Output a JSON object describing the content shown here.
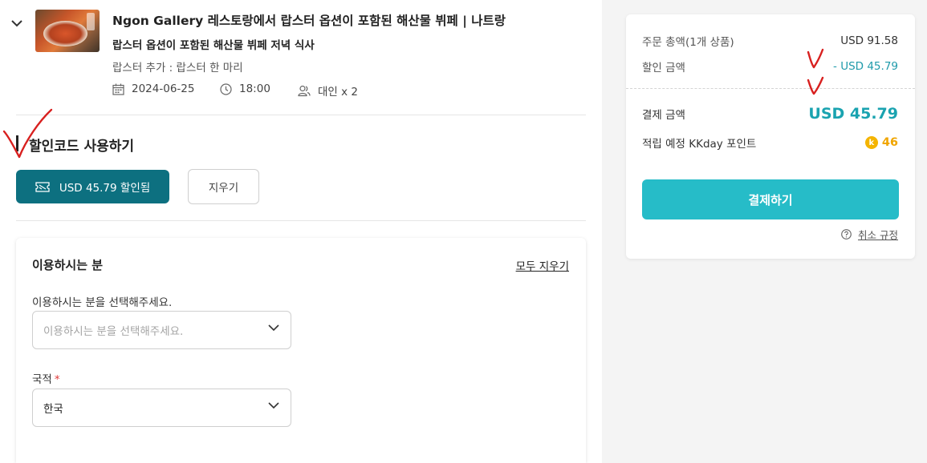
{
  "product": {
    "title": "Ngon Gallery 레스토랑에서 랍스터 옵션이 포함된 해산물 뷔페 | 나트랑",
    "package": "랍스터 옵션이 포함된 해산물 뷔페 저녁 식사",
    "option": "랍스터 추가 : 랍스터 한 마리",
    "date": "2024-06-25",
    "time": "18:00",
    "quantity": "대인 x 2"
  },
  "coupon": {
    "section_title": "할인코드 사용하기",
    "applied_label": "USD 45.79 할인됨",
    "clear_label": "지우기"
  },
  "traveler": {
    "title": "이용하시는 분",
    "clear_all": "모두 지우기",
    "select_label": "이용하시는 분을 선택해주세요.",
    "select_placeholder": "이용하시는 분을 선택해주세요.",
    "nationality_label": "국적",
    "required_mark": "*",
    "nationality_value": "한국"
  },
  "summary": {
    "total_label": "주문 총액(1개 상품)",
    "total_value": "USD 91.58",
    "discount_label": "할인 금액",
    "discount_value": "- USD 45.79",
    "pay_amount_label": "결제 금액",
    "pay_amount_value": "USD 45.79",
    "points_label": "적립 예정 KKday 포인트",
    "points_coin": "k",
    "points_value": "46",
    "pay_button": "결제하기",
    "cancel_policy": "취소 규정"
  },
  "colors": {
    "teal_dark": "#0d7080",
    "teal": "#26bcc8",
    "teal_text": "#1aa3b0",
    "coin": "#f4b400",
    "annotation_red": "#d8201f"
  },
  "icons": [
    "chevron-down-icon",
    "calendar-icon",
    "clock-icon",
    "people-icon",
    "ticket-icon",
    "question-icon",
    "kkday-coin-icon"
  ]
}
